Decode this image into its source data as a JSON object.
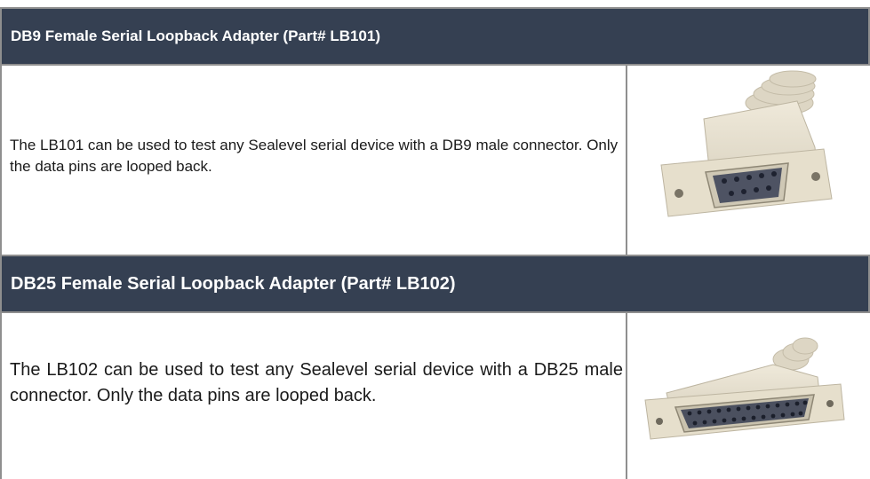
{
  "sections": [
    {
      "header": "DB9 Female Serial Loopback Adapter (Part# LB101)",
      "description": "The LB101 can be used to test any Sealevel serial device with a DB9 male connector. Only the data pins are looped back.",
      "image_icon": "db9-female-connector-image"
    },
    {
      "header": "DB25 Female Serial Loopback Adapter (Part# LB102)",
      "description": "The LB102 can be used to test any Sealevel serial device with a DB25 male connector. Only the data pins are looped back.",
      "image_icon": "db25-female-connector-image"
    }
  ],
  "colors": {
    "header_background": "#354052",
    "header_text": "#ffffff",
    "border": "#8f8f8f",
    "body_text": "#1a1a1a",
    "connector_body": "#e8e1cf"
  }
}
